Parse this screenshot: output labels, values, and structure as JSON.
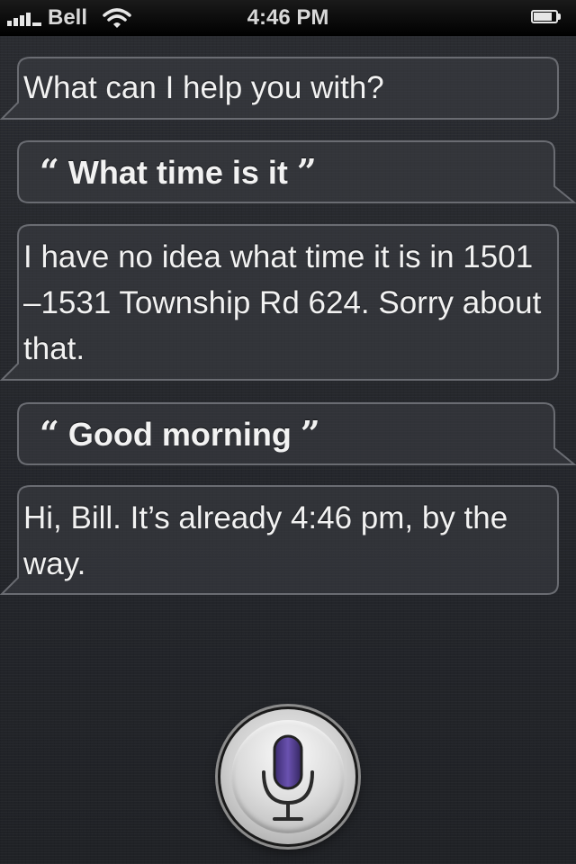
{
  "status_bar": {
    "carrier": "Bell",
    "time": "4:46 PM",
    "signal_icon": "signal-bars-icon",
    "wifi_icon": "wifi-icon",
    "battery_icon": "battery-icon"
  },
  "conversation": [
    {
      "speaker": "assistant",
      "text": "What can I help you with?"
    },
    {
      "speaker": "user",
      "text": "What time is it"
    },
    {
      "speaker": "assistant",
      "text": "I have no idea what time it is in 1501 –1531 Township Rd 624. Sorry about that."
    },
    {
      "speaker": "user",
      "text": "Good morning"
    },
    {
      "speaker": "assistant",
      "text": "Hi, Bill. It’s already 4:46 pm, by the way."
    }
  ],
  "quotes": {
    "open": "“",
    "close": "”"
  },
  "mic_button": {
    "icon": "microphone-icon",
    "accent_color": "#5a3e9a"
  }
}
